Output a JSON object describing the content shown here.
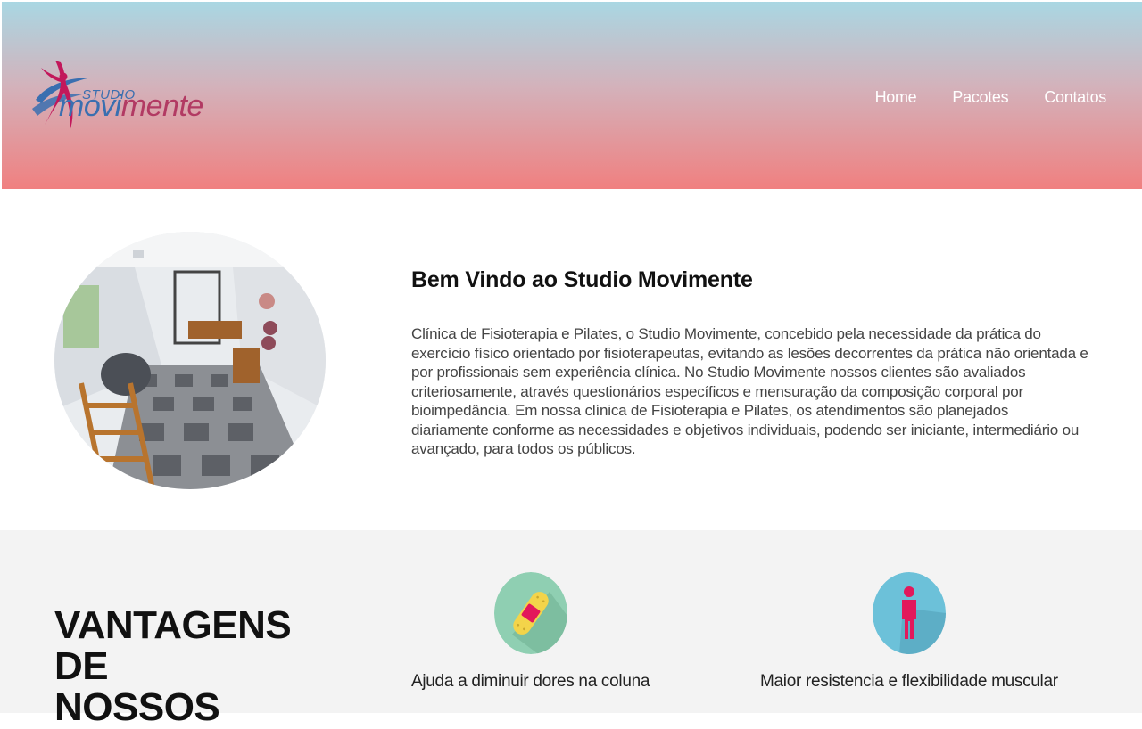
{
  "header": {
    "logo": {
      "studio": "STUDIO",
      "word_start": "movi",
      "word_end": "mente"
    },
    "nav": [
      {
        "label": "Home"
      },
      {
        "label": "Pacotes"
      },
      {
        "label": "Contatos"
      }
    ],
    "colors": {
      "gradient_top": "#a9d7e3",
      "gradient_bottom": "#f08080",
      "logo_blue": "#3a6fb0",
      "logo_magenta": "#b23a63"
    }
  },
  "welcome": {
    "title": "Bem Vindo ao Studio Movimente",
    "text": "Clínica de Fisioterapia e Pilates, o Studio Movimente, concebido pela necessidade da prática do exercício físico orientado por fisioterapeutas, evitando as lesões decorrentes da prática não orientada e por profissionais sem experiência clínica. No Studio Movimente nossos clientes são avaliados criteriosamente, através questionários específicos e mensuração da composição corporal por bioimpedância. Em nossa clínica de Fisioterapia e Pilates, os atendimentos são planejados diariamente conforme as necessidades e objetivos individuais, podendo ser iniciante, intermediário ou avançado, para todos os públicos.",
    "image": "pilates-studio-room-photo"
  },
  "advantages": {
    "title_lines": [
      "VANTAGENS",
      "DE",
      "NOSSOS"
    ],
    "items": [
      {
        "icon": "bandage-icon",
        "label": "Ajuda a diminuir dores na coluna",
        "icon_bg": "#8fcfb2"
      },
      {
        "icon": "person-icon",
        "label": "Maior resistencia e flexibilidade muscular",
        "icon_bg": "#6cc1d9"
      }
    ]
  }
}
